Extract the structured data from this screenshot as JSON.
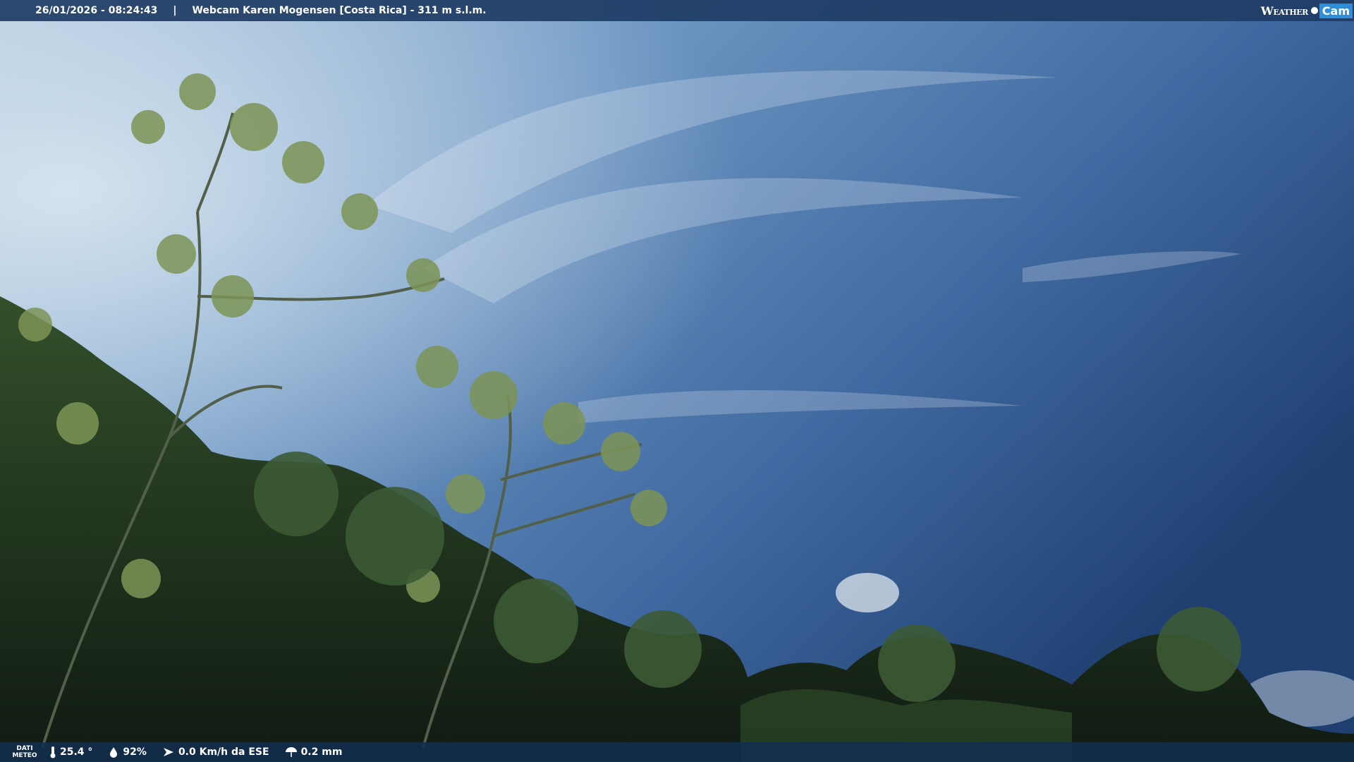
{
  "header": {
    "datetime": "26/01/2026 - 08:24:43",
    "separator": "|",
    "title": "Webcam Karen Mogensen [Costa Rica]  - 311 m s.l.m."
  },
  "logo": {
    "word1": "Weather",
    "word2": "Cam"
  },
  "footer": {
    "label_line1": "DATI",
    "label_line2": "METEO",
    "temperature": "25.4 °",
    "humidity": "92%",
    "wind": "0.0 Km/h da ESE",
    "rain": "0.2 mm"
  },
  "icons": [
    "thermometer-icon",
    "humidity-icon",
    "wind-icon",
    "rain-icon"
  ],
  "colors": {
    "bar": "#1e3c64",
    "logo_accent": "#2d8fd8"
  }
}
